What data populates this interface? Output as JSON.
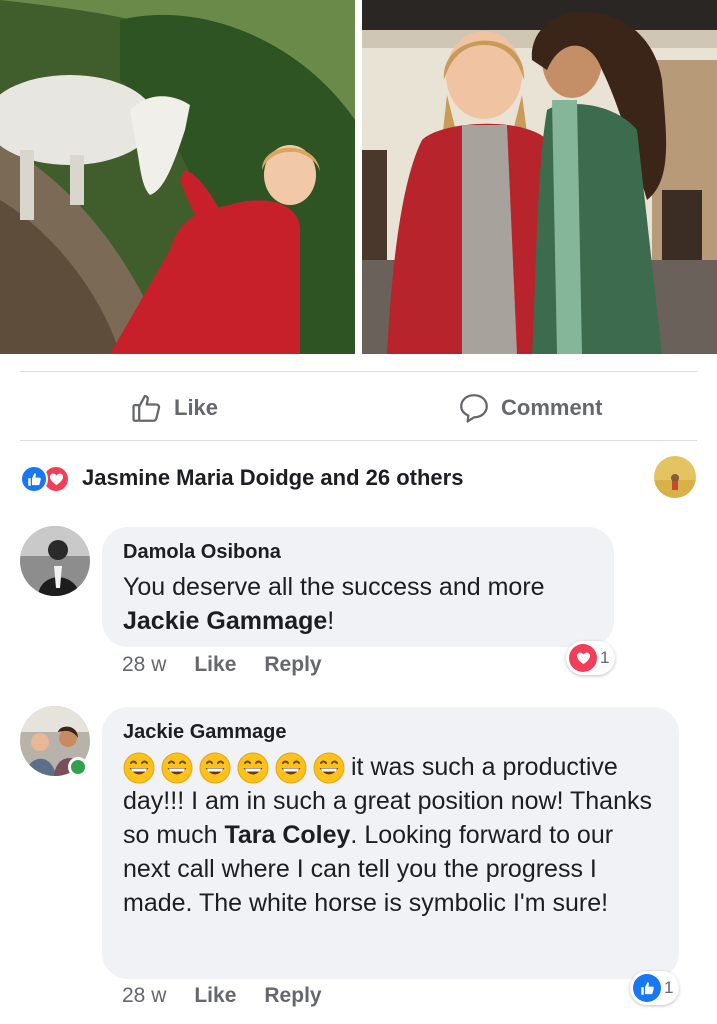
{
  "post": {
    "actions": {
      "like_label": "Like",
      "comment_label": "Comment"
    },
    "reactions": {
      "summary": "Jasmine Maria Doidge and 26 others"
    }
  },
  "comments": [
    {
      "author": "Damola Osibona",
      "text_before": "You deserve all the success and more ",
      "mention": "Jackie Gammage",
      "text_after": "!",
      "time": "28 w",
      "like_label": "Like",
      "reply_label": "Reply",
      "reaction_icon": "heart-icon",
      "reaction_count": "1"
    },
    {
      "author": "Jackie Gammage",
      "emoji_icon": "grinning-face-icon",
      "emoji_count": 6,
      "text_before": "it was such a productive day!!! I am in such a great position now! Thanks so much ",
      "mention": "Tara Coley",
      "text_after": ". Looking forward to our next call where I can tell you the progress I made. The white horse is symbolic I'm sure!",
      "time": "28 w",
      "like_label": "Like",
      "reply_label": "Reply",
      "reaction_icon": "thumbs-up-icon",
      "reaction_count": "1"
    }
  ],
  "colors": {
    "like_blue": "#1877f2",
    "love_red": "#f33e58",
    "bubble_bg": "#f0f2f5",
    "meta_gray": "#65676b",
    "online_green": "#31a24c"
  }
}
